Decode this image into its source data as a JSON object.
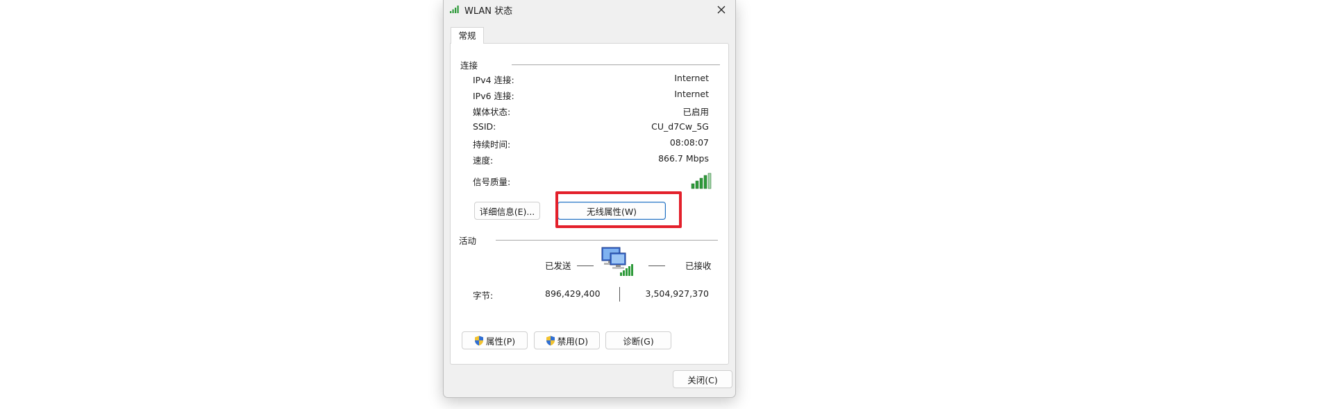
{
  "window": {
    "title": "WLAN 状态",
    "title_icon": "wifi-signal-icon",
    "close_icon": "close-icon"
  },
  "tabs": [
    {
      "label": "常规",
      "selected": true
    }
  ],
  "connection": {
    "section_label": "连接",
    "rows": [
      {
        "label": "IPv4 连接:",
        "value": "Internet"
      },
      {
        "label": "IPv6 连接:",
        "value": "Internet"
      },
      {
        "label": "媒体状态:",
        "value": "已启用"
      },
      {
        "label": "SSID:",
        "value": "CU_d7Cw_5G"
      },
      {
        "label": "持续时间:",
        "value": "08:08:07"
      },
      {
        "label": "速度:",
        "value": "866.7 Mbps"
      }
    ],
    "signal_label": "信号质量:",
    "signal_icon": "signal-strength-icon",
    "details_button": "详细信息(E)...",
    "wireless_props_button": "无线属性(W)"
  },
  "activity": {
    "section_label": "活动",
    "sent_label": "已发送",
    "received_label": "已接收",
    "network_icon": "network-computers-icon",
    "bytes_label": "字节:",
    "bytes_sent": "896,429,400",
    "bytes_received": "3,504,927,370"
  },
  "bottom_buttons": {
    "properties": "属性(P)",
    "disable": "禁用(D)",
    "diagnose": "诊断(G)",
    "shield_icon": "uac-shield-icon"
  },
  "close_button": "关闭(C)",
  "colors": {
    "highlight": "#e3202b",
    "signal_green": "#2e9a3a",
    "focus_border": "#1f6fc0"
  }
}
